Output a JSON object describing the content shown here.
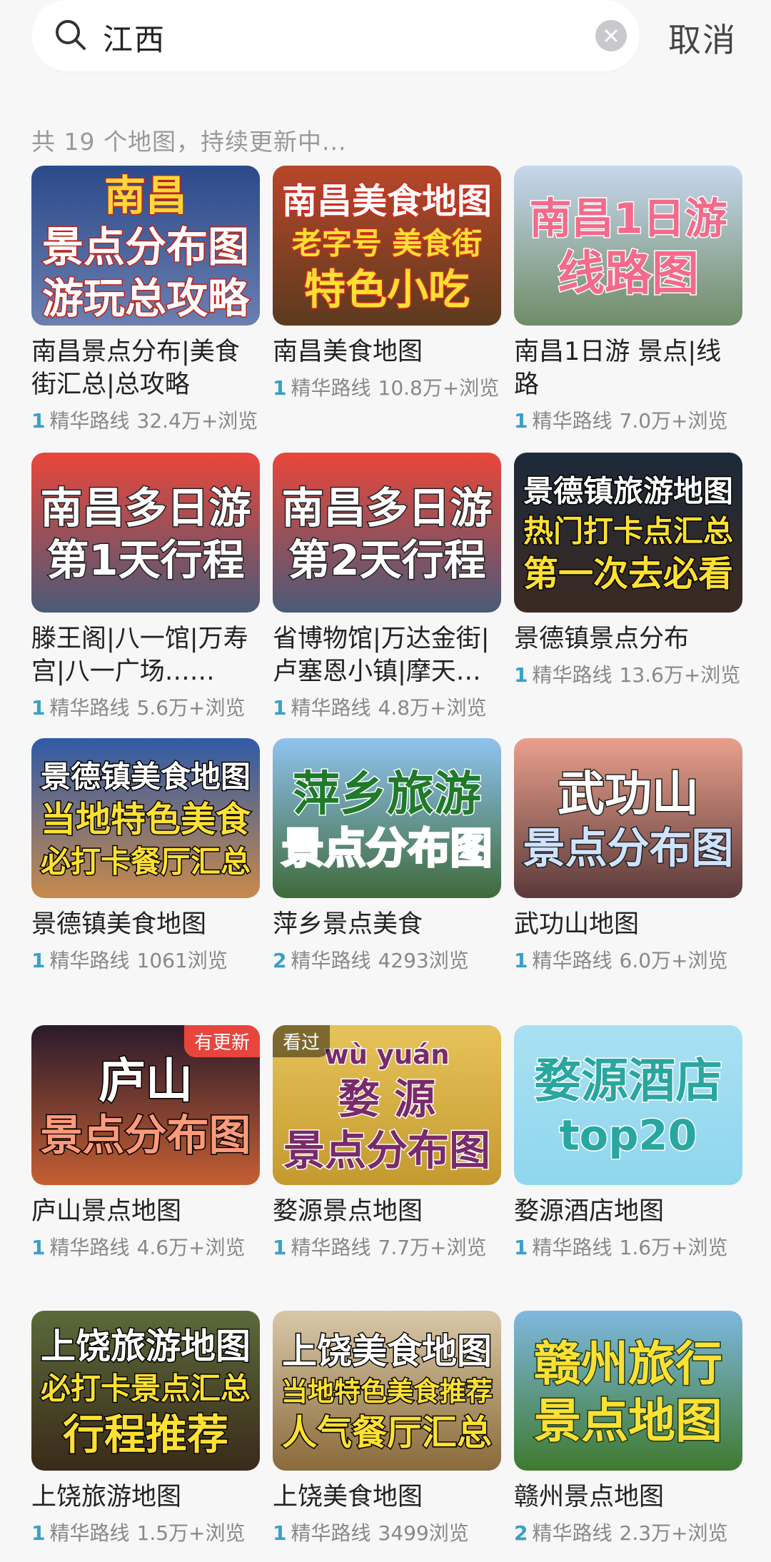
{
  "search": {
    "query": "江西",
    "cancel_label": "取消"
  },
  "result_count_text": "共 19 个地图，持续更新中...",
  "route_label": "精华路线",
  "cards": [
    {
      "title": "南昌景点分布|美食街汇总|总攻略",
      "routes": "1",
      "views": "32.4万+浏览",
      "thumb_lines": [
        "南昌",
        "景点分布图",
        "游玩总攻略"
      ],
      "badge": ""
    },
    {
      "title": "南昌美食地图",
      "routes": "1",
      "views": "10.8万+浏览",
      "thumb_lines": [
        "南昌美食地图",
        "老字号 美食街",
        "特色小吃"
      ],
      "badge": ""
    },
    {
      "title": "南昌1日游 景点|线路",
      "routes": "1",
      "views": "7.0万+浏览",
      "thumb_lines": [
        "南昌1日游",
        "线路图"
      ],
      "badge": ""
    },
    {
      "title": "滕王阁|八一馆|万寿宫|八一广场……",
      "routes": "1",
      "views": "5.6万+浏览",
      "thumb_lines": [
        "南昌多日游",
        "第1天行程"
      ],
      "badge": ""
    },
    {
      "title": "省博物馆|万达金街|卢塞恩小镇|摩天…",
      "routes": "1",
      "views": "4.8万+浏览",
      "thumb_lines": [
        "南昌多日游",
        "第2天行程"
      ],
      "badge": ""
    },
    {
      "title": "景德镇景点分布",
      "routes": "1",
      "views": "13.6万+浏览",
      "thumb_lines": [
        "景德镇旅游地图",
        "热门打卡点汇总",
        "第一次去必看"
      ],
      "badge": ""
    },
    {
      "title": "景德镇美食地图",
      "routes": "1",
      "views": "1061浏览",
      "thumb_lines": [
        "景德镇美食地图",
        "当地特色美食",
        "必打卡餐厅汇总"
      ],
      "badge": ""
    },
    {
      "title": "萍乡景点美食",
      "routes": "2",
      "views": "4293浏览",
      "thumb_lines": [
        "萍乡旅游",
        "景点分布图"
      ],
      "badge": ""
    },
    {
      "title": "武功山地图",
      "routes": "1",
      "views": "6.0万+浏览",
      "thumb_lines": [
        "武功山",
        "景点分布图"
      ],
      "badge": ""
    },
    {
      "title": "庐山景点地图",
      "routes": "1",
      "views": "4.6万+浏览",
      "thumb_lines": [
        "庐山",
        "景点分布图"
      ],
      "badge": "有更新"
    },
    {
      "title": "婺源景点地图",
      "routes": "1",
      "views": "7.7万+浏览",
      "thumb_lines": [
        "wù  yuán",
        "婺 源",
        "景点分布图"
      ],
      "badge": "看过"
    },
    {
      "title": "婺源酒店地图",
      "routes": "1",
      "views": "1.6万+浏览",
      "thumb_lines": [
        "婺源酒店",
        "top20"
      ],
      "badge": ""
    },
    {
      "title": "上饶旅游地图",
      "routes": "1",
      "views": "1.5万+浏览",
      "thumb_lines": [
        "上饶旅游地图",
        "必打卡景点汇总",
        "行程推荐"
      ],
      "badge": ""
    },
    {
      "title": "上饶美食地图",
      "routes": "1",
      "views": "3499浏览",
      "thumb_lines": [
        "上饶美食地图",
        "当地特色美食推荐",
        "人气餐厅汇总"
      ],
      "badge": ""
    },
    {
      "title": "赣州景点地图",
      "routes": "2",
      "views": "2.3万+浏览",
      "thumb_lines": [
        "赣州旅行",
        "景点地图"
      ],
      "badge": ""
    }
  ],
  "watermark": "…"
}
